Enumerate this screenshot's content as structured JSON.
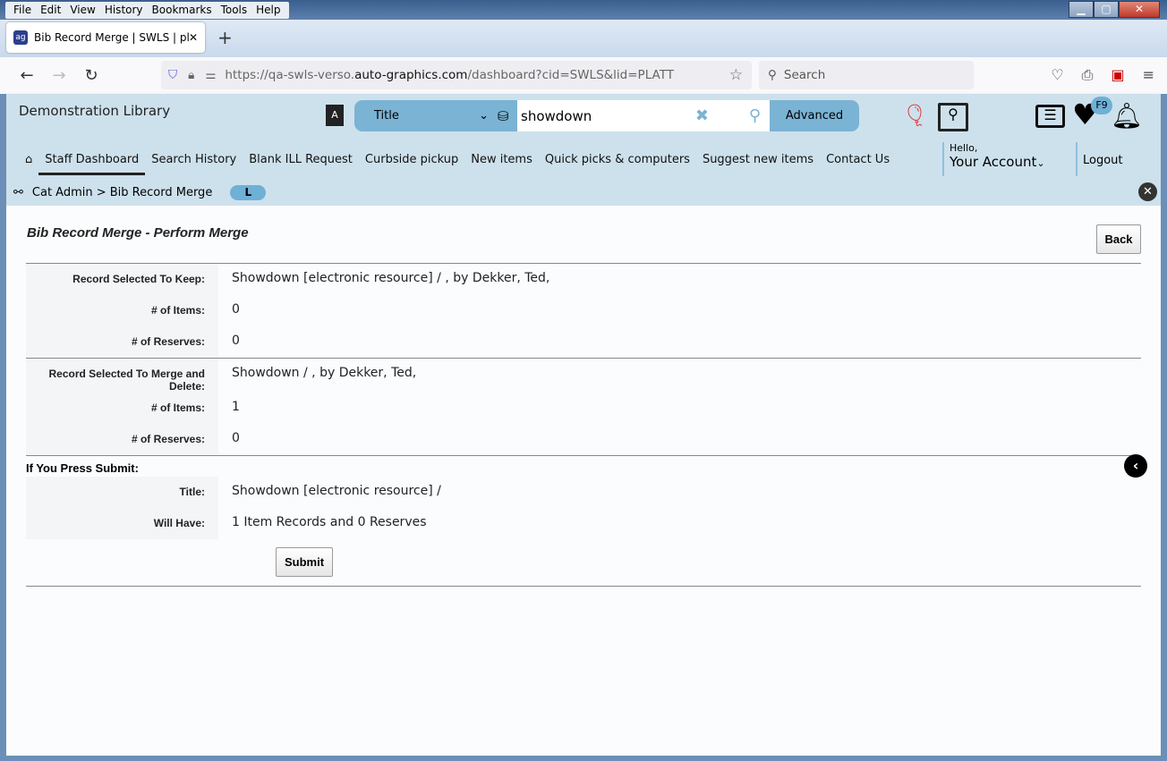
{
  "browser": {
    "menu": [
      "File",
      "Edit",
      "View",
      "History",
      "Bookmarks",
      "Tools",
      "Help"
    ],
    "tab_title": "Bib Record Merge | SWLS | platt",
    "url_prefix": "https://qa-swls-verso.",
    "url_domain": "auto-graphics.com",
    "url_suffix": "/dashboard?cid=SWLS&lid=PLATT",
    "search_placeholder": "Search"
  },
  "header": {
    "library": "Demonstration Library",
    "search_type": "Title",
    "search_value": "showdown",
    "advanced": "Advanced",
    "badge": "F9",
    "hello": "Hello,",
    "account": "Your Account",
    "logout": "Logout",
    "menu": [
      "Staff Dashboard",
      "Search History",
      "Blank ILL Request",
      "Curbside pickup",
      "New items",
      "Quick picks & computers",
      "Suggest new items",
      "Contact Us"
    ]
  },
  "breadcrumb": {
    "path": "Cat Admin > Bib Record Merge",
    "pill": "L"
  },
  "main": {
    "title": "Bib Record Merge - Perform Merge",
    "back": "Back",
    "keep": [
      {
        "label": "Record Selected To Keep:",
        "value": "Showdown [electronic resource] / , by Dekker, Ted,"
      },
      {
        "label": "# of Items:",
        "value": "0"
      },
      {
        "label": "# of Reserves:",
        "value": "0"
      }
    ],
    "merge": [
      {
        "label": "Record Selected To Merge and Delete:",
        "value": "Showdown / , by Dekker, Ted,"
      },
      {
        "label": "# of Items:",
        "value": "1"
      },
      {
        "label": "# of Reserves:",
        "value": "0"
      }
    ],
    "submit_heading": "If You Press Submit:",
    "result": [
      {
        "label": "Title:",
        "value": "Showdown [electronic resource] /"
      },
      {
        "label": "Will Have:",
        "value": "1 Item Records and 0 Reserves"
      }
    ],
    "submit": "Submit"
  }
}
